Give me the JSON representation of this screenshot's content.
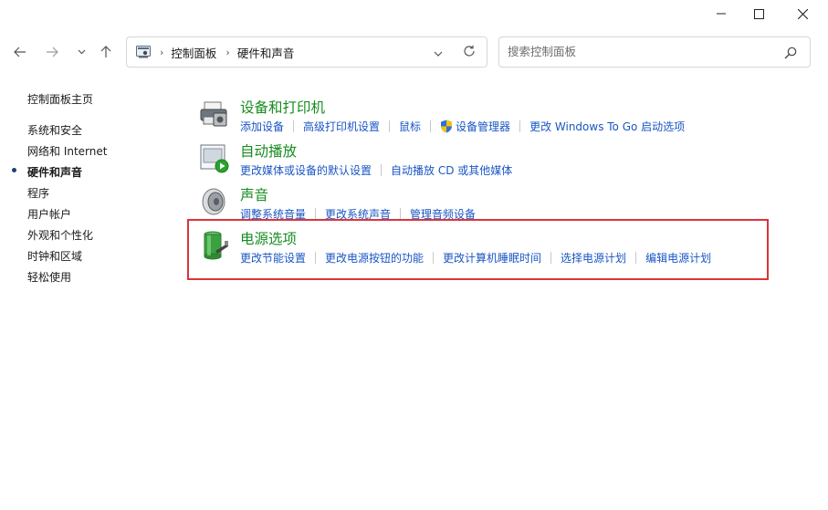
{
  "window": {
    "controls": {
      "minimize": "minimize",
      "maximize": "maximize",
      "close": "close"
    }
  },
  "nav": {
    "back": "back",
    "forward": "forward",
    "recent": "recent",
    "up": "up"
  },
  "address": {
    "breadcrumbs": [
      "控制面板",
      "硬件和声音"
    ]
  },
  "search": {
    "placeholder": "搜索控制面板"
  },
  "sidebar": {
    "items": [
      {
        "label": "控制面板主页"
      },
      {
        "label": "系统和安全"
      },
      {
        "label": "网络和 Internet"
      },
      {
        "label": "硬件和声音",
        "current": true
      },
      {
        "label": "程序"
      },
      {
        "label": "用户帐户"
      },
      {
        "label": "外观和个性化"
      },
      {
        "label": "时钟和区域"
      },
      {
        "label": "轻松使用"
      }
    ]
  },
  "categories": [
    {
      "title": "设备和打印机",
      "icon": "printer-icon",
      "links": [
        "添加设备",
        "高级打印机设置",
        "鼠标",
        "设备管理器",
        "更改 Windows To Go 启动选项"
      ]
    },
    {
      "title": "自动播放",
      "icon": "autoplay-icon",
      "links": [
        "更改媒体或设备的默认设置",
        "自动播放 CD 或其他媒体"
      ]
    },
    {
      "title": "声音",
      "icon": "speaker-icon",
      "links": [
        "调整系统音量",
        "更改系统声音",
        "管理音频设备"
      ]
    },
    {
      "title": "电源选项",
      "icon": "battery-icon",
      "links": [
        "更改节能设置",
        "更改电源按钮的功能",
        "更改计算机睡眠时间",
        "选择电源计划",
        "编辑电源计划"
      ]
    }
  ],
  "colors": {
    "category_title": "#178c1f",
    "link": "#1a56c4",
    "highlight": "#d9353b"
  }
}
